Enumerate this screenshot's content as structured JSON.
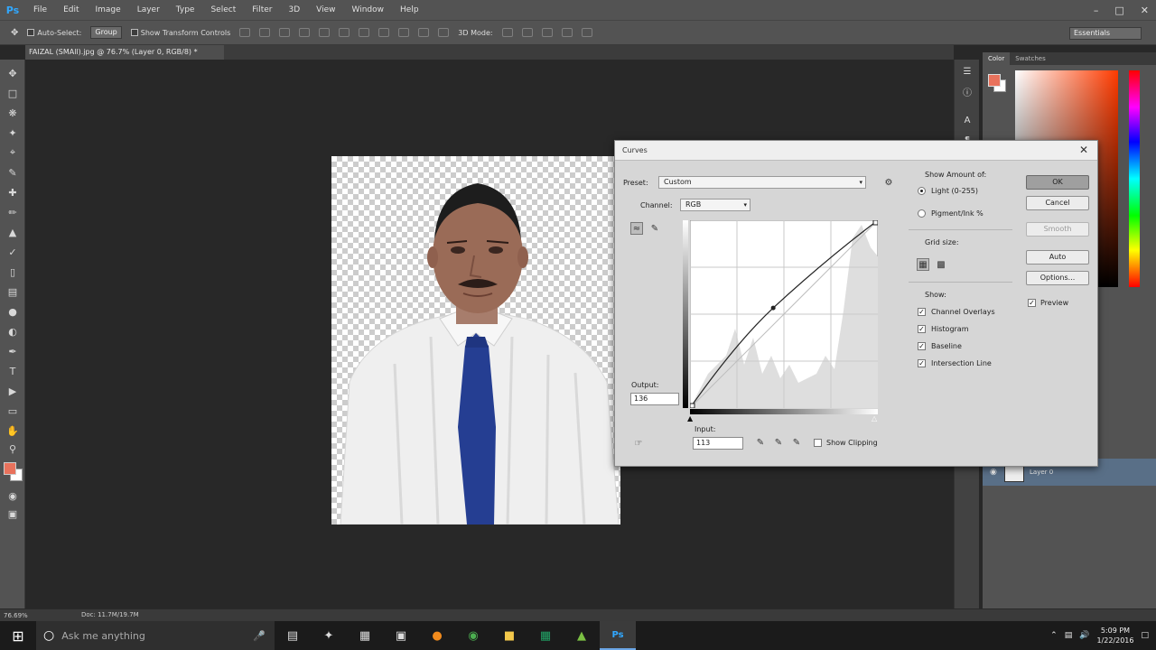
{
  "app": {
    "logo": "Ps",
    "menu": [
      "File",
      "Edit",
      "Image",
      "Layer",
      "Type",
      "Select",
      "Filter",
      "3D",
      "View",
      "Window",
      "Help"
    ]
  },
  "options_bar": {
    "auto_select_label": "Auto-Select:",
    "auto_select_value": "Group",
    "show_transform_label": "Show Transform Controls",
    "mode_3d": "3D Mode:",
    "workspace": "Essentials"
  },
  "document": {
    "tab_title": "FAIZAL (SMAll).jpg @ 76.7% (Layer 0, RGB/8) *",
    "zoom": "76.69%",
    "doc_info": "Doc: 11.7M/19.7M"
  },
  "panels": {
    "color_tab": "Color",
    "swatches_tab": "Swatches",
    "fg_color": "#e9725c",
    "bg_color": "#ffffff",
    "layer_name": "Layer 0"
  },
  "curves": {
    "title": "Curves",
    "preset_label": "Preset:",
    "preset_value": "Custom",
    "channel_label": "Channel:",
    "channel_value": "RGB",
    "output_label": "Output:",
    "output_value": "136",
    "input_label": "Input:",
    "input_value": "113",
    "show_clipping": "Show Clipping",
    "show_amount_label": "Show Amount of:",
    "light_option": "Light  (0-255)",
    "pigment_option": "Pigment/Ink %",
    "grid_size_label": "Grid size:",
    "show_label": "Show:",
    "show_options": [
      "Channel Overlays",
      "Histogram",
      "Baseline",
      "Intersection Line"
    ],
    "buttons": {
      "ok": "OK",
      "cancel": "Cancel",
      "smooth": "Smooth",
      "auto": "Auto",
      "options": "Options..."
    },
    "preview_label": "Preview",
    "control_point": {
      "input": 113,
      "output": 136
    }
  },
  "taskbar": {
    "search_placeholder": "Ask me anything",
    "time": "5:09 PM",
    "date": "1/22/2016"
  }
}
